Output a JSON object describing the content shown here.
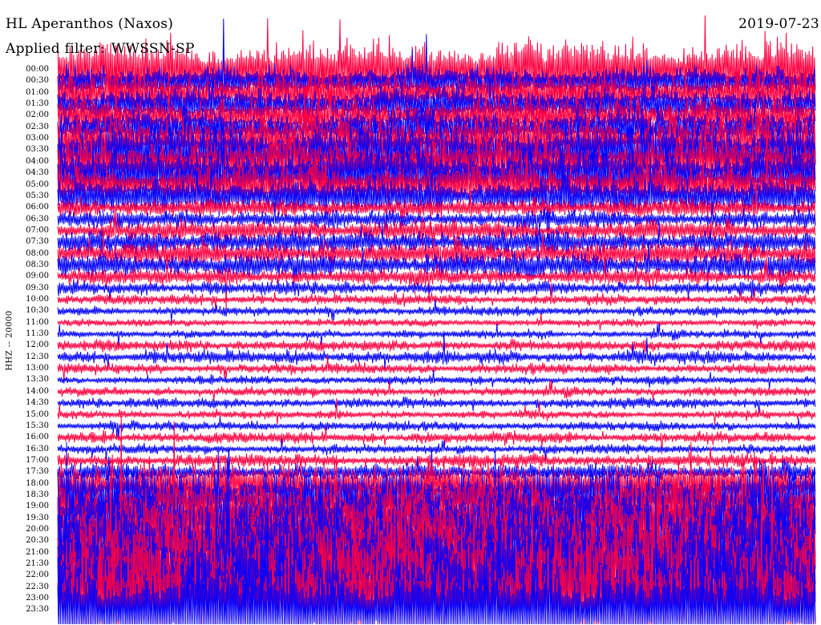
{
  "header": {
    "station": "HL Aperanthos (Naxos)",
    "filter_label": "Applied filter:",
    "filter_name": "WWSSN-SP",
    "date": "2019-07-23"
  },
  "colors": {
    "trace_a": "#ff0040",
    "trace_b": "#0000ff",
    "background": "#ffffff",
    "text": "#000000"
  },
  "chart_data": {
    "type": "line",
    "title": "HL Aperanthos (Naxos)",
    "subtitle": "Applied filter: WWSSN-SP",
    "ylabel": "HHZ -- 20000",
    "y_tick_labels": [
      "00:00",
      "00:30",
      "01:00",
      "01:30",
      "02:00",
      "02:30",
      "03:00",
      "03:30",
      "04:00",
      "04:30",
      "05:00",
      "05:30",
      "06:00",
      "06:30",
      "07:00",
      "07:30",
      "08:00",
      "08:30",
      "09:00",
      "09:30",
      "10:00",
      "10:30",
      "11:00",
      "11:30",
      "12:00",
      "12:30",
      "13:00",
      "13:30",
      "14:00",
      "14:30",
      "15:00",
      "15:30",
      "16:00",
      "16:30",
      "17:00",
      "17:30",
      "18:00",
      "18:30",
      "19:00",
      "19:30",
      "20:00",
      "20:30",
      "21:00",
      "21:30",
      "22:00",
      "22:30",
      "23:00",
      "23:30"
    ],
    "x_minutes_per_line": 30,
    "alternating_colors": [
      "#ff0040",
      "#0000ff"
    ],
    "line_amplitudes": [
      3.2,
      1.6,
      2.2,
      1.8,
      2.0,
      1.8,
      2.6,
      2.8,
      2.6,
      2.6,
      2.2,
      1.9,
      1.0,
      0.9,
      1.1,
      1.2,
      1.3,
      1.3,
      0.9,
      0.7,
      0.55,
      0.5,
      0.4,
      0.45,
      0.6,
      0.7,
      0.55,
      0.45,
      0.5,
      0.55,
      0.45,
      0.5,
      0.6,
      0.5,
      0.7,
      0.9,
      2.4,
      2.8,
      3.2,
      3.4,
      3.8,
      4.0,
      4.2,
      4.6,
      5.0,
      5.0,
      5.0,
      5.0
    ]
  }
}
